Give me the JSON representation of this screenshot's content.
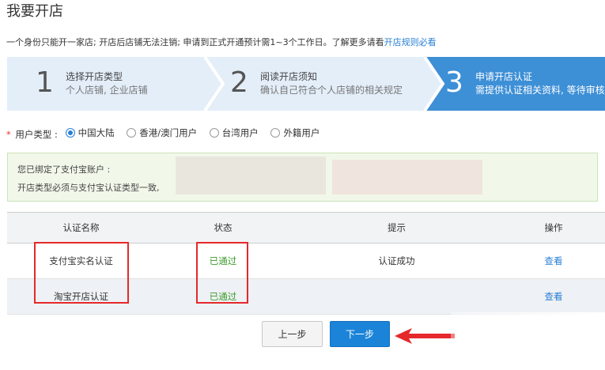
{
  "page": {
    "title": "我要开店"
  },
  "notice": {
    "text": "一个身份只能开一家店; 开店后店铺无法注销; 申请到正式开通预计需1~3个工作日。了解更多请看",
    "link": "开店规则必看"
  },
  "steps": [
    {
      "num": "1",
      "title": "选择开店类型",
      "desc": "个人店铺, 企业店铺"
    },
    {
      "num": "2",
      "title": "阅读开店须知",
      "desc": "确认自己符合个人店铺的相关规定"
    },
    {
      "num": "3",
      "title": "申请开店认证",
      "desc": "需提供认证相关资料, 等待审核"
    }
  ],
  "user_type": {
    "label": "用户类型 :",
    "options": [
      "中国大陆",
      "香港/澳门用户",
      "台湾用户",
      "外籍用户"
    ],
    "selected": "中国大陆"
  },
  "alipay": {
    "line1": "您已绑定了支付宝账户 :",
    "line2": "开店类型必须与支付宝认证类型一致,"
  },
  "table": {
    "headers": [
      "认证名称",
      "状态",
      "提示",
      "操作"
    ],
    "rows": [
      {
        "name": "支付宝实名认证",
        "status": "已通过",
        "hint": "认证成功",
        "action": "查看"
      },
      {
        "name": "淘宝开店认证",
        "status": "已通过",
        "hint": "",
        "action": "查看"
      }
    ]
  },
  "buttons": {
    "prev": "上一步",
    "next": "下一步"
  },
  "colors": {
    "accent": "#1b84d8",
    "step_active": "#3d8fd6",
    "step_inactive": "#e3eef9",
    "pass": "#3c9a2a",
    "highlight": "#e5282b"
  }
}
